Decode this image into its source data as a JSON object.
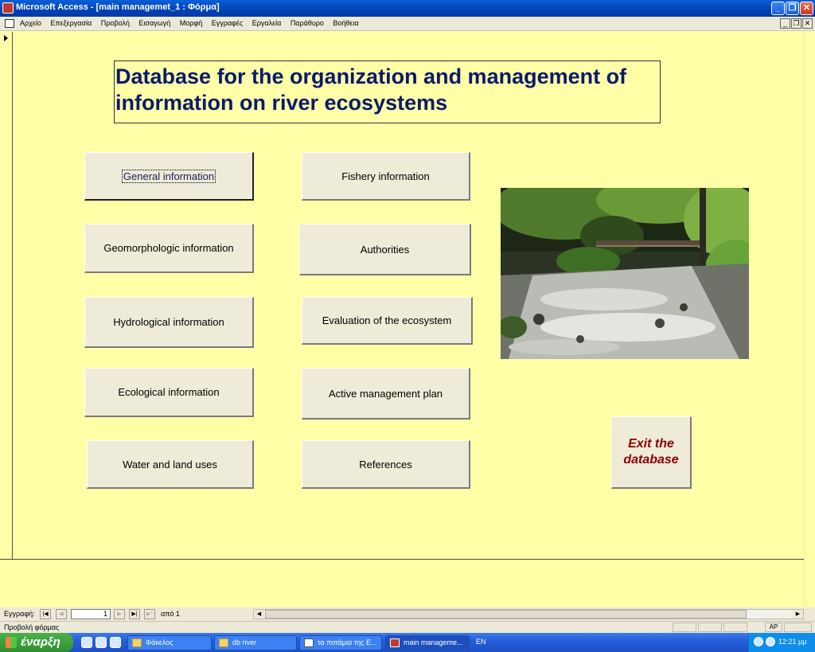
{
  "window": {
    "title": "Microsoft Access - [main managemet_1 : Φόρμα]",
    "minimize_label": "_",
    "restore_label": "❐",
    "close_label": "✕"
  },
  "menubar": {
    "items": [
      "Αρχείο",
      "Επεξεργασία",
      "Προβολή",
      "Εισαγωγή",
      "Μορφή",
      "Εγγραφές",
      "Εργαλεία",
      "Παράθυρο",
      "Βοήθεια"
    ],
    "mdi_minimize": "_",
    "mdi_restore": "❐",
    "mdi_close": "✕"
  },
  "form": {
    "heading": "Database for the organization and management of information on river ecosystems",
    "buttons": {
      "general": "General information",
      "geomorphologic": "Geomorphologic information",
      "hydrological": "Hydrological information",
      "ecological": "Ecological information",
      "water_land": "Water and land uses",
      "fishery": "Fishery information",
      "authorities": "Authorities",
      "evaluation": "Evaluation of the ecosystem",
      "management_plan": "Active management plan",
      "references": "References",
      "exit_line1": "Exit the",
      "exit_line2": "database"
    }
  },
  "navigation": {
    "record_label": "Εγγραφή:",
    "first": "|◀",
    "prev": "◀",
    "current_record": "1",
    "next": "▶",
    "last": "▶|",
    "new": "▶*",
    "of_total": "από 1",
    "scroll_left": "◀",
    "scroll_right": "▶"
  },
  "statusbar": {
    "text": "Προβολή φόρμας",
    "indicator": "ΑΡ"
  },
  "taskbar": {
    "start_label": "έναρξη",
    "tasks": [
      {
        "label": "Φάκελος",
        "active": false
      },
      {
        "label": "db river",
        "active": false
      },
      {
        "label": "τα ποτάμια της Ε...",
        "active": false
      },
      {
        "label": "main manageme...",
        "active": true
      }
    ],
    "language": "EN",
    "clock": "12:21 μμ"
  },
  "colors": {
    "form_background": "#ffffa8",
    "heading_text": "#0a1a6b",
    "exit_text": "#8b0000",
    "button_face": "#eeebd9"
  }
}
